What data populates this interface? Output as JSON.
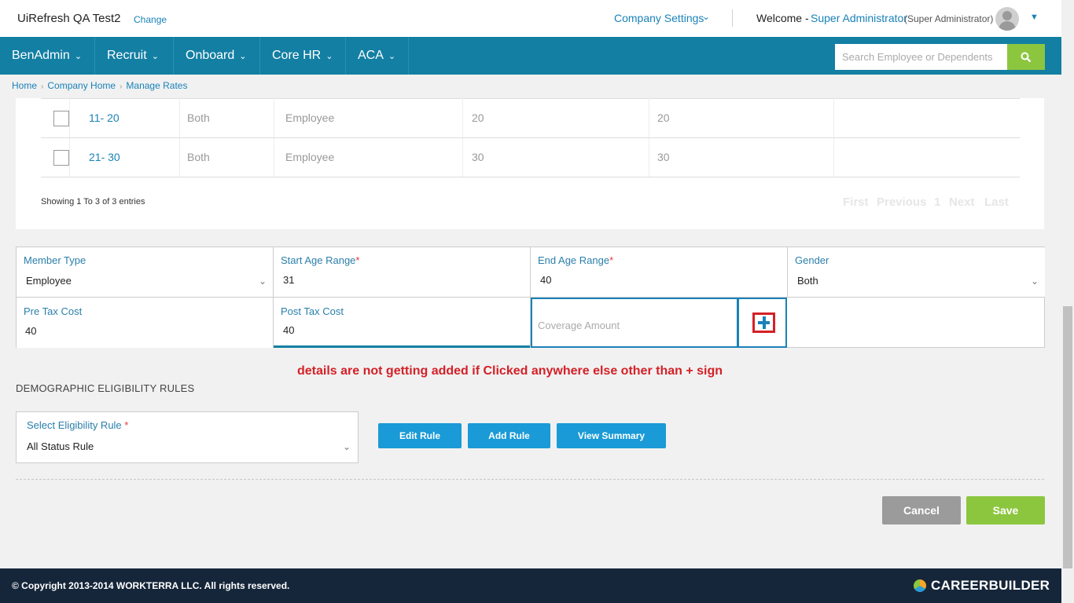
{
  "header": {
    "company_name": "UiRefresh QA Test2",
    "change_label": "Change",
    "company_settings_label": "Company Settings",
    "welcome_label": "Welcome -",
    "user_name": "Super Administrator",
    "user_role": "(Super Administrator)"
  },
  "nav": {
    "items": [
      {
        "label": "BenAdmin"
      },
      {
        "label": "Recruit"
      },
      {
        "label": "Onboard"
      },
      {
        "label": "Core HR"
      },
      {
        "label": "ACA"
      }
    ],
    "search_placeholder": "Search Employee or Dependents"
  },
  "breadcrumb": [
    "Home",
    "Company Home",
    "Manage Rates"
  ],
  "table": {
    "rows": [
      {
        "range": "11- 20",
        "gender": "Both",
        "member_type": "Employee",
        "pre_tax": "20",
        "post_tax": "20"
      },
      {
        "range": "21- 30",
        "gender": "Both",
        "member_type": "Employee",
        "pre_tax": "30",
        "post_tax": "30"
      }
    ],
    "entries_text": "Showing 1 To 3 of 3 entries",
    "pager": {
      "first": "First",
      "previous": "Previous",
      "page": "1",
      "next": "Next",
      "last": "Last"
    }
  },
  "form": {
    "member_type": {
      "label": "Member Type",
      "value": "Employee"
    },
    "start_age": {
      "label": "Start Age Range",
      "required": "*",
      "value": "31"
    },
    "end_age": {
      "label": "End Age Range",
      "required": "*",
      "value": "40"
    },
    "gender": {
      "label": "Gender",
      "value": "Both"
    },
    "pre_tax": {
      "label": "Pre Tax Cost",
      "value": "40"
    },
    "post_tax": {
      "label": "Post Tax Cost",
      "value": "40"
    },
    "coverage": {
      "placeholder": "Coverage Amount"
    }
  },
  "annotation": "details  are not getting added if Clicked anywhere else other than + sign",
  "demographic": {
    "title": "DEMOGRAPHIC ELIGIBILITY RULES",
    "select_label": "Select Eligibility Rule",
    "required": "*",
    "select_value": "All Status Rule",
    "edit_rule": "Edit Rule",
    "add_rule": "Add Rule",
    "view_summary": "View Summary"
  },
  "actions": {
    "cancel": "Cancel",
    "save": "Save"
  },
  "footer": {
    "copyright": "© Copyright 2013-2014 WORKTERRA LLC. All rights reserved.",
    "brand": "CAREERBUILDER"
  },
  "colors": {
    "nav_bg": "#137fa3",
    "accent_green": "#8cc63f",
    "link_blue": "#1a82b8",
    "alert_red": "#d42027",
    "footer_bg": "#16263a"
  }
}
